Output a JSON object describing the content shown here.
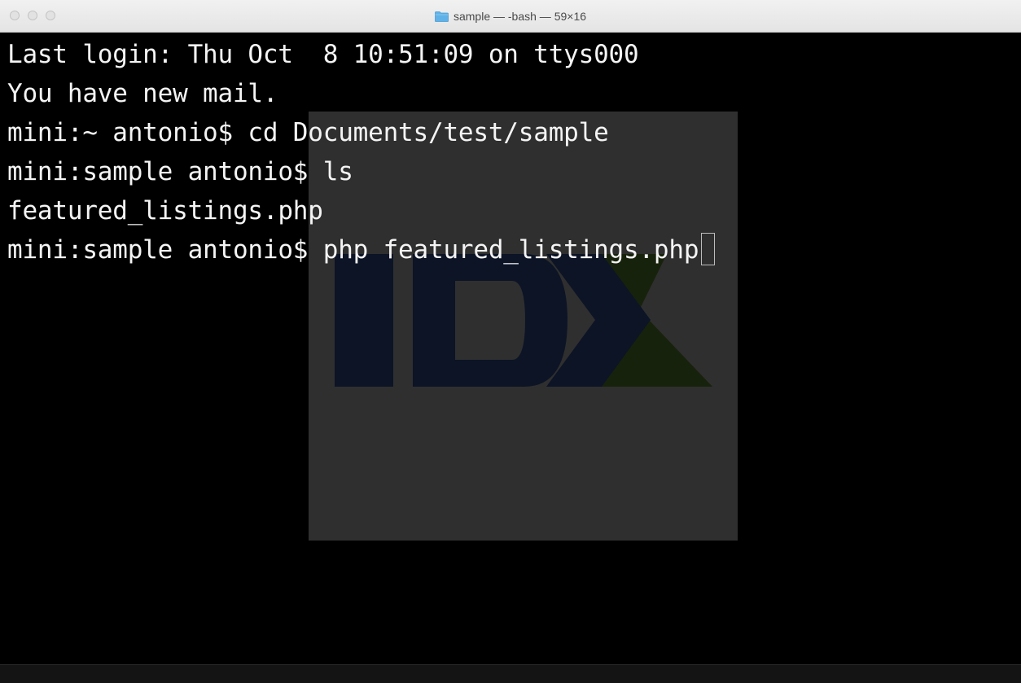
{
  "window": {
    "title": "sample — -bash — 59×16",
    "folder_color": "#5fb2e8"
  },
  "terminal": {
    "foreground": "#f4f4f4",
    "background": "#000000",
    "lines": [
      "Last login: Thu Oct  8 10:51:09 on ttys000",
      "You have new mail.",
      "mini:~ antonio$ cd Documents/test/sample",
      "mini:sample antonio$ ls",
      "featured_listings.php",
      "mini:sample antonio$ php featured_listings.php"
    ]
  },
  "watermark": {
    "text": "IDX",
    "colors": {
      "panel": "#2f2f2f",
      "letters": "#0c1426",
      "x_accent": "#17220c"
    }
  }
}
